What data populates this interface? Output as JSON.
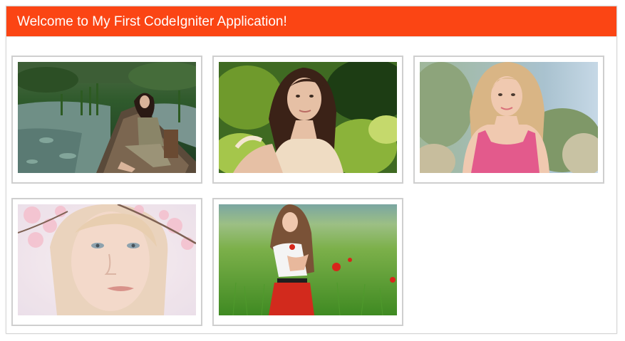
{
  "header": {
    "title": "Welcome to My First CodeIgniter Application!"
  },
  "colors": {
    "header_background": "#fb4514",
    "header_text": "#ffffff",
    "thumbnail_border": "#cfcfcf"
  },
  "gallery": {
    "images": [
      {
        "subject": "woman sitting in a wooden boat on a swamp"
      },
      {
        "subject": "brunette woman in front of green foliage"
      },
      {
        "subject": "blonde woman in pink top outdoors"
      },
      {
        "subject": "close-up face of blonde woman with cherry blossoms"
      },
      {
        "subject": "woman in red skirt in a green field with poppies"
      }
    ]
  }
}
